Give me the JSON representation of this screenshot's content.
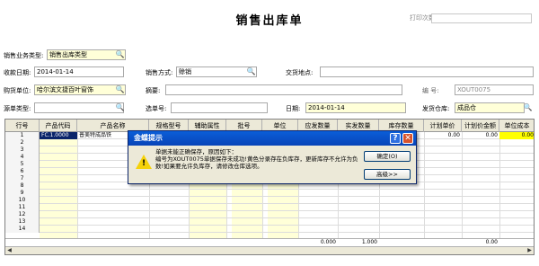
{
  "header": {
    "title": "销售出库单",
    "print_count_label": "打印次数:"
  },
  "form": {
    "business_type_label": "销售业务类型:",
    "business_type_value": "销售出库类型",
    "receive_date_label": "收款日期:",
    "receive_date_value": "2014-01-14",
    "sales_method_label": "销售方式:",
    "sales_method_value": "赊销",
    "delivery_place_label": "交货地点:",
    "buyer_label": "购货单位:",
    "buyer_value": "哈尔滨文捷百叶窗饰",
    "summary_label": "摘要:",
    "number_label": "编  号:",
    "number_value": "XOUT0075",
    "source_type_label": "源单类型:",
    "select_number_label": "选单号:",
    "date_label": "日期:",
    "date_value": "2014-01-14",
    "warehouse_label": "发货仓库:",
    "warehouse_value": "成品仓"
  },
  "grid": {
    "columns": [
      "行号",
      "产品代码",
      "产品名称",
      "规格型号",
      "辅助属性",
      "批号",
      "单位",
      "应发数量",
      "实发数量",
      "库存数量",
      "计划单价",
      "计划价金额",
      "单位成本"
    ],
    "row_numbers": [
      "1",
      "2",
      "3",
      "4",
      "5",
      "6",
      "7",
      "8",
      "9",
      "10",
      "11",
      "12",
      "13",
      "14"
    ],
    "row1": {
      "code": "FC.1.0000",
      "name": "普美特成品铁",
      "plan_price": "0.00",
      "plan_amount": "0.00",
      "unit_cost": "0.00"
    },
    "footer": {
      "due_qty": "0.000",
      "actual_qty": "1.000",
      "plan_amount": "0.00"
    }
  },
  "dialog": {
    "title": "金蝶提示",
    "message": "单据未能正确保存，原因如下：\n编号为XOUT0075单据保存未成功!黄色分录存在负库存，更新库存不允许为负数!如果要允许负库存，请修改仓库选项。",
    "ok_label": "确定(O)",
    "advanced_label": "高级>>",
    "help_glyph": "?",
    "close_glyph": "✕"
  }
}
